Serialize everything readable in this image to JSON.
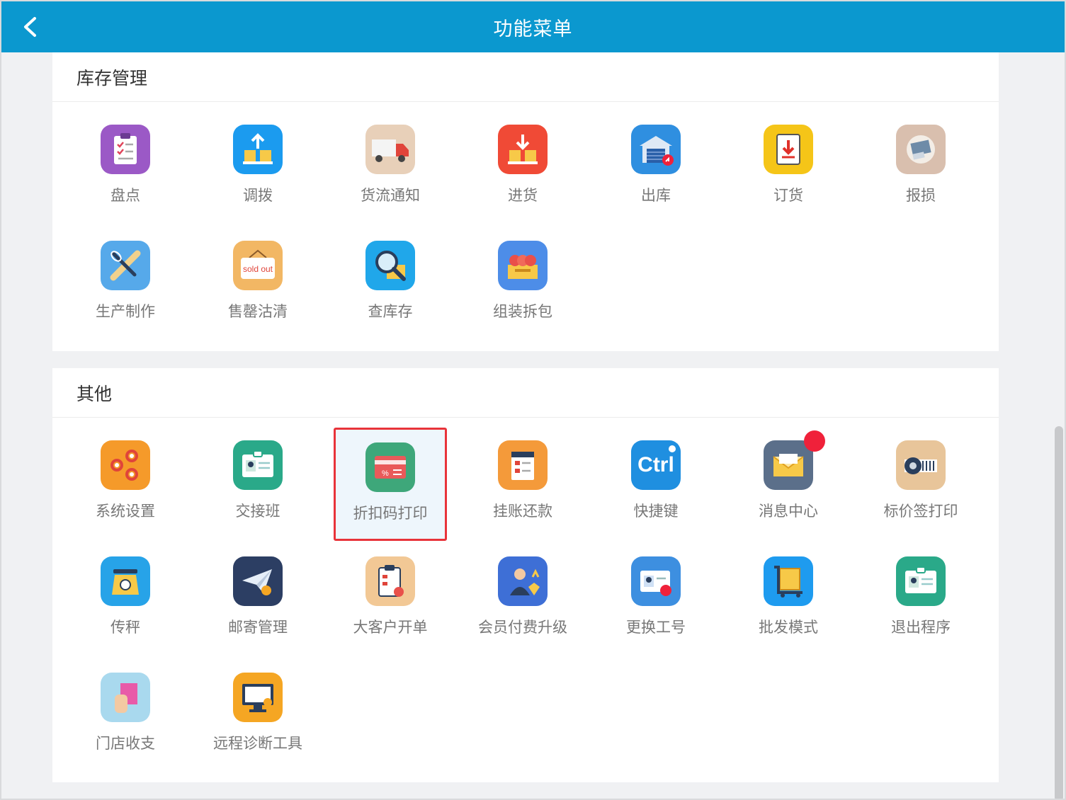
{
  "header": {
    "title": "功能菜单"
  },
  "sections": [
    {
      "title": "库存管理",
      "items": [
        {
          "label": "盘点",
          "icon": "clipboard-checklist-icon",
          "color": "#9b59c6"
        },
        {
          "label": "调拨",
          "icon": "transfer-boxes-icon",
          "color": "#1b9bef"
        },
        {
          "label": "货流通知",
          "icon": "delivery-truck-icon",
          "color": "#e8d0b9"
        },
        {
          "label": "进货",
          "icon": "stock-in-icon",
          "color": "#f04a36"
        },
        {
          "label": "出库",
          "icon": "warehouse-out-icon",
          "color": "#2f8fe0"
        },
        {
          "label": "订货",
          "icon": "order-download-icon",
          "color": "#f5c518"
        },
        {
          "label": "报损",
          "icon": "damaged-goods-icon",
          "color": "#d9bfae"
        },
        {
          "label": "生产制作",
          "icon": "baking-tools-icon",
          "color": "#56a9ea"
        },
        {
          "label": "售罄沽清",
          "icon": "sold-out-sign-icon",
          "color": "#f2b764",
          "icon_text": "sold out"
        },
        {
          "label": "查库存",
          "icon": "magnifier-stock-icon",
          "color": "#20a7ea"
        },
        {
          "label": "组装拆包",
          "icon": "gift-bundle-icon",
          "color": "#4d8de8"
        }
      ]
    },
    {
      "title": "其他",
      "items": [
        {
          "label": "系统设置",
          "icon": "gears-icon",
          "color": "#f59a2a"
        },
        {
          "label": "交接班",
          "icon": "id-badge-icon",
          "color": "#2aa989"
        },
        {
          "label": "折扣码打印",
          "icon": "discount-card-icon",
          "color": "#3ea77a",
          "selected": true
        },
        {
          "label": "挂账还款",
          "icon": "ledger-icon",
          "color": "#f49a3a"
        },
        {
          "label": "快捷键",
          "icon": "ctrl-key-icon",
          "color": "#1f8fe0",
          "icon_text": "Ctrl"
        },
        {
          "label": "消息中心",
          "icon": "envelope-icon",
          "color": "#5b6f8a",
          "badge": true
        },
        {
          "label": "标价签打印",
          "icon": "label-roll-icon",
          "color": "#e8c59a"
        },
        {
          "label": "传秤",
          "icon": "scale-icon",
          "color": "#27a3e8"
        },
        {
          "label": "邮寄管理",
          "icon": "paper-plane-icon",
          "color": "#2c3e63"
        },
        {
          "label": "大客户开单",
          "icon": "clipboard-order-icon",
          "color": "#f2c895"
        },
        {
          "label": "会员付费升级",
          "icon": "vip-upgrade-icon",
          "color": "#3e6fd6"
        },
        {
          "label": "更换工号",
          "icon": "swap-id-icon",
          "color": "#3d8fe0"
        },
        {
          "label": "批发模式",
          "icon": "wholesale-cart-icon",
          "color": "#1e9bef"
        },
        {
          "label": "退出程序",
          "icon": "exit-badge-icon",
          "color": "#2aa989"
        },
        {
          "label": "门店收支",
          "icon": "store-receipt-icon",
          "color": "#a9d9ee"
        },
        {
          "label": "远程诊断工具",
          "icon": "remote-monitor-icon",
          "color": "#f5a623"
        }
      ]
    }
  ]
}
